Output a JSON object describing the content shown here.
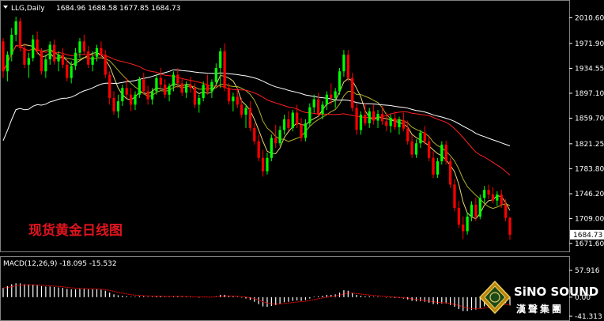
{
  "header": {
    "symbol": "LLG,Daily",
    "ohlc": "1684.96 1688.58 1677.85 1684.73"
  },
  "watermark_label": "现货黄金日线图",
  "price_axis": {
    "ticks": [
      "2010.60",
      "1971.90",
      "1934.55",
      "1897.10",
      "1859.70",
      "1821.25",
      "1783.80",
      "1746.20",
      "1709.00",
      "1671.60"
    ],
    "current_price": "1684.73"
  },
  "macd": {
    "header": "MACD(12,26,9) -18.095 -15.532",
    "ticks": [
      "57.916",
      "0.00",
      "-41.313"
    ]
  },
  "logo": {
    "name": "SiNO SOUND",
    "chinese": "漢聲集團"
  },
  "colors": {
    "background": "#000000",
    "bull": "#00ff00",
    "bear": "#ff0000",
    "ma_white": "#ffffff",
    "ma_red": "#ff2020",
    "ma_khaki": "#e8d878",
    "ma_olive": "#b0b030",
    "macd_hist": "#ffffff",
    "macd_signal": "#ff0000"
  },
  "chart_data": {
    "type": "candlestick",
    "title": "LLG,Daily",
    "ylim": [
      1662,
      2030
    ],
    "candles": [
      [
        1975,
        1980,
        1920,
        1930
      ],
      [
        1930,
        1960,
        1915,
        1955
      ],
      [
        1955,
        1995,
        1945,
        1985
      ],
      [
        1985,
        2012,
        1975,
        2005
      ],
      [
        2005,
        2010,
        1960,
        1965
      ],
      [
        1965,
        1972,
        1935,
        1940
      ],
      [
        1940,
        1958,
        1920,
        1950
      ],
      [
        1950,
        1985,
        1945,
        1978
      ],
      [
        1978,
        1990,
        1955,
        1960
      ],
      [
        1960,
        1965,
        1925,
        1930
      ],
      [
        1930,
        1955,
        1920,
        1948
      ],
      [
        1948,
        1975,
        1940,
        1970
      ],
      [
        1970,
        1978,
        1940,
        1945
      ],
      [
        1945,
        1960,
        1930,
        1955
      ],
      [
        1955,
        1965,
        1935,
        1940
      ],
      [
        1940,
        1948,
        1915,
        1920
      ],
      [
        1920,
        1945,
        1912,
        1938
      ],
      [
        1938,
        1965,
        1932,
        1958
      ],
      [
        1958,
        1980,
        1950,
        1975
      ],
      [
        1975,
        1985,
        1955,
        1960
      ],
      [
        1960,
        1968,
        1935,
        1940
      ],
      [
        1940,
        1960,
        1930,
        1952
      ],
      [
        1952,
        1970,
        1945,
        1965
      ],
      [
        1965,
        1975,
        1950,
        1955
      ],
      [
        1955,
        1962,
        1920,
        1925
      ],
      [
        1925,
        1930,
        1880,
        1890
      ],
      [
        1890,
        1900,
        1865,
        1870
      ],
      [
        1870,
        1895,
        1860,
        1885
      ],
      [
        1885,
        1910,
        1878,
        1905
      ],
      [
        1905,
        1920,
        1890,
        1895
      ],
      [
        1895,
        1905,
        1870,
        1880
      ],
      [
        1880,
        1900,
        1872,
        1895
      ],
      [
        1895,
        1922,
        1890,
        1918
      ],
      [
        1918,
        1928,
        1895,
        1900
      ],
      [
        1900,
        1908,
        1880,
        1888
      ],
      [
        1888,
        1905,
        1880,
        1900
      ],
      [
        1900,
        1925,
        1895,
        1920
      ],
      [
        1920,
        1935,
        1905,
        1910
      ],
      [
        1910,
        1918,
        1890,
        1895
      ],
      [
        1895,
        1912,
        1885,
        1908
      ],
      [
        1908,
        1930,
        1900,
        1925
      ],
      [
        1925,
        1935,
        1905,
        1912
      ],
      [
        1912,
        1920,
        1893,
        1898
      ],
      [
        1898,
        1915,
        1890,
        1910
      ],
      [
        1910,
        1922,
        1898,
        1905
      ],
      [
        1905,
        1912,
        1875,
        1880
      ],
      [
        1880,
        1895,
        1868,
        1890
      ],
      [
        1890,
        1915,
        1885,
        1910
      ],
      [
        1910,
        1925,
        1895,
        1900
      ],
      [
        1900,
        1918,
        1890,
        1914
      ],
      [
        1914,
        1942,
        1908,
        1935
      ],
      [
        1935,
        1965,
        1905,
        1960
      ],
      [
        1960,
        1972,
        1900,
        1905
      ],
      [
        1905,
        1912,
        1880,
        1885
      ],
      [
        1885,
        1898,
        1870,
        1892
      ],
      [
        1892,
        1905,
        1875,
        1880
      ],
      [
        1880,
        1890,
        1860,
        1865
      ],
      [
        1865,
        1880,
        1845,
        1875
      ],
      [
        1875,
        1885,
        1840,
        1845
      ],
      [
        1845,
        1852,
        1820,
        1825
      ],
      [
        1825,
        1835,
        1795,
        1800
      ],
      [
        1800,
        1812,
        1772,
        1780
      ],
      [
        1780,
        1808,
        1775,
        1800
      ],
      [
        1800,
        1835,
        1795,
        1830
      ],
      [
        1830,
        1850,
        1815,
        1822
      ],
      [
        1822,
        1848,
        1818,
        1842
      ],
      [
        1842,
        1865,
        1835,
        1858
      ],
      [
        1858,
        1870,
        1840,
        1845
      ],
      [
        1845,
        1872,
        1840,
        1868
      ],
      [
        1868,
        1880,
        1845,
        1850
      ],
      [
        1850,
        1860,
        1825,
        1830
      ],
      [
        1830,
        1858,
        1825,
        1852
      ],
      [
        1852,
        1882,
        1848,
        1876
      ],
      [
        1876,
        1895,
        1868,
        1888
      ],
      [
        1888,
        1898,
        1862,
        1866
      ],
      [
        1866,
        1885,
        1858,
        1880
      ],
      [
        1880,
        1900,
        1872,
        1895
      ],
      [
        1895,
        1912,
        1880,
        1890
      ],
      [
        1890,
        1905,
        1875,
        1900
      ],
      [
        1900,
        1935,
        1895,
        1930
      ],
      [
        1930,
        1962,
        1922,
        1955
      ],
      [
        1955,
        1962,
        1915,
        1920
      ],
      [
        1920,
        1928,
        1870,
        1875
      ],
      [
        1875,
        1882,
        1835,
        1842
      ],
      [
        1842,
        1870,
        1835,
        1865
      ],
      [
        1865,
        1882,
        1848,
        1852
      ],
      [
        1852,
        1875,
        1845,
        1870
      ],
      [
        1870,
        1880,
        1850,
        1856
      ],
      [
        1856,
        1872,
        1845,
        1866
      ],
      [
        1866,
        1878,
        1850,
        1855
      ],
      [
        1855,
        1868,
        1840,
        1848
      ],
      [
        1848,
        1865,
        1838,
        1860
      ],
      [
        1860,
        1870,
        1842,
        1846
      ],
      [
        1846,
        1862,
        1835,
        1857
      ],
      [
        1857,
        1868,
        1840,
        1844
      ],
      [
        1844,
        1856,
        1820,
        1825
      ],
      [
        1825,
        1835,
        1800,
        1805
      ],
      [
        1805,
        1828,
        1800,
        1822
      ],
      [
        1822,
        1842,
        1815,
        1838
      ],
      [
        1838,
        1848,
        1820,
        1825
      ],
      [
        1825,
        1832,
        1795,
        1800
      ],
      [
        1800,
        1810,
        1770,
        1775
      ],
      [
        1775,
        1800,
        1770,
        1795
      ],
      [
        1795,
        1825,
        1790,
        1820
      ],
      [
        1820,
        1826,
        1790,
        1795
      ],
      [
        1795,
        1800,
        1755,
        1760
      ],
      [
        1760,
        1768,
        1720,
        1725
      ],
      [
        1725,
        1735,
        1695,
        1700
      ],
      [
        1700,
        1712,
        1678,
        1690
      ],
      [
        1690,
        1718,
        1685,
        1712
      ],
      [
        1712,
        1735,
        1705,
        1730
      ],
      [
        1730,
        1740,
        1705,
        1712
      ],
      [
        1712,
        1745,
        1708,
        1740
      ],
      [
        1740,
        1758,
        1732,
        1752
      ],
      [
        1752,
        1760,
        1738,
        1745
      ],
      [
        1745,
        1756,
        1732,
        1736
      ],
      [
        1736,
        1750,
        1728,
        1745
      ],
      [
        1745,
        1752,
        1725,
        1730
      ],
      [
        1730,
        1738,
        1705,
        1710
      ],
      [
        1710,
        1712,
        1677,
        1684.73
      ]
    ],
    "macd_hist": [
      20,
      24,
      28,
      30,
      30,
      28,
      27,
      27,
      26,
      24,
      23,
      23,
      22,
      21,
      20,
      18,
      17,
      17,
      18,
      18,
      17,
      17,
      17,
      16,
      14,
      10,
      6,
      4,
      3,
      2,
      1,
      1,
      2,
      2,
      1,
      1,
      2,
      2,
      1,
      1,
      2,
      2,
      1,
      1,
      1,
      0,
      -1,
      0,
      0,
      0,
      2,
      5,
      5,
      3,
      2,
      1,
      -1,
      -3,
      -6,
      -10,
      -15,
      -20,
      -21,
      -19,
      -17,
      -14,
      -11,
      -10,
      -8,
      -7,
      -8,
      -6,
      -3,
      1,
      2,
      3,
      5,
      5,
      6,
      10,
      15,
      14,
      10,
      5,
      3,
      2,
      2,
      1,
      1,
      0,
      -1,
      -1,
      -2,
      -2,
      -3,
      -5,
      -8,
      -9,
      -9,
      -10,
      -12,
      -15,
      -15,
      -14,
      -14,
      -17,
      -21,
      -26,
      -30,
      -30,
      -28,
      -27,
      -24,
      -20,
      -17,
      -15,
      -13,
      -12,
      -13,
      -18
    ],
    "macd_signal_start": 22,
    "macd_ylim": [
      -41.313,
      57.916
    ]
  }
}
